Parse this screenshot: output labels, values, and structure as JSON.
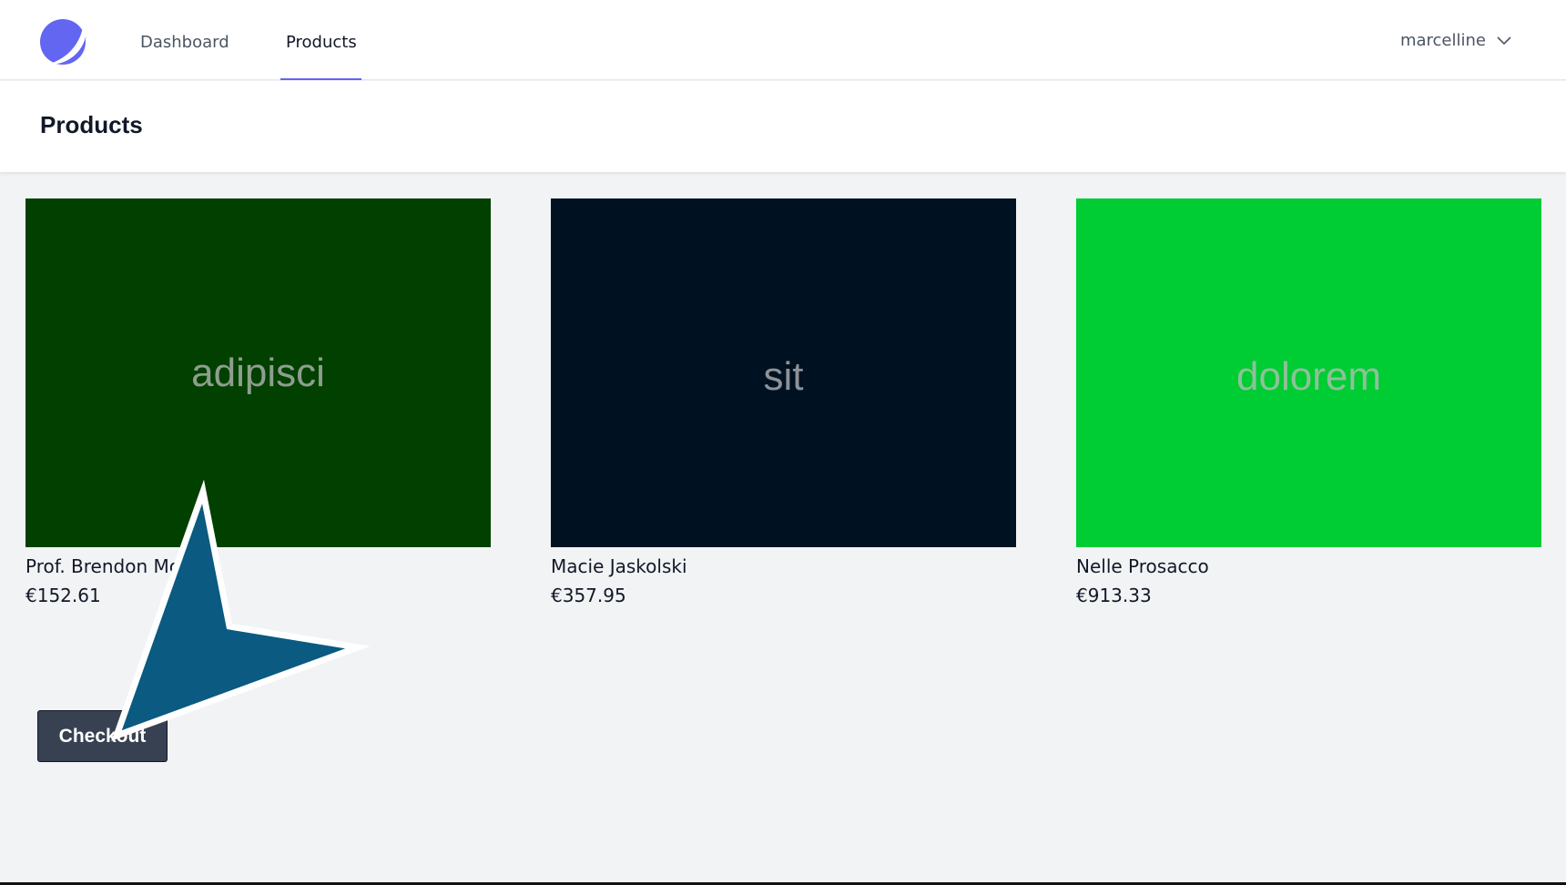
{
  "nav": {
    "links": [
      {
        "label": "Dashboard",
        "active": false
      },
      {
        "label": "Products",
        "active": true
      }
    ],
    "user": {
      "name": "marcelline",
      "icon": "chevron-down-icon"
    },
    "logo_icon": "app-logo-icon",
    "accent_color": "#6366f1"
  },
  "header": {
    "title": "Products"
  },
  "products": [
    {
      "image_text": "adipisci",
      "image_color": "#024000",
      "name": "Prof. Brendon Mc",
      "price": "€152.61"
    },
    {
      "image_text": "sit",
      "image_color": "#001122",
      "name": "Macie Jaskolski",
      "price": "€357.95"
    },
    {
      "image_text": "dolorem",
      "image_color": "#00cc33",
      "name": "Nelle Prosacco",
      "price": "€913.33"
    }
  ],
  "checkout": {
    "label": "Checkout"
  },
  "cursor": {
    "icon": "pointer-arrow-icon",
    "color": "#0a5a82"
  }
}
